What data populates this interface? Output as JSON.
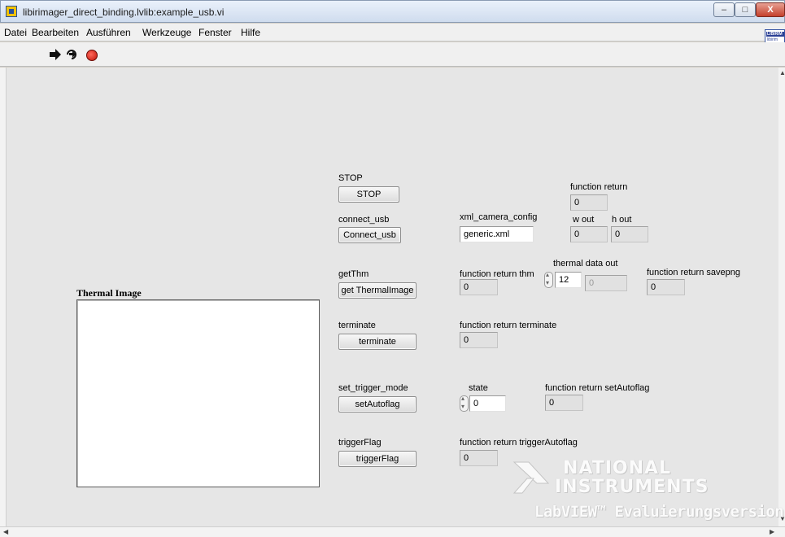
{
  "window": {
    "title": "libirimager_direct_binding.lvlib:example_usb.vi",
    "minimize_glyph": "–",
    "maximize_glyph": "□",
    "close_glyph": "X"
  },
  "menu": {
    "items": [
      "Datei",
      "Bearbeiten",
      "Ausführen",
      "Werkzeuge",
      "Fenster",
      "Hilfe"
    ]
  },
  "vi_icon": {
    "line1": "LIBIRIM",
    "line2": "libirim"
  },
  "toolbar": {
    "icons": [
      "run-arrow-icon",
      "run-continuously-icon",
      "abort-icon"
    ]
  },
  "panel": {
    "stop": {
      "label": "STOP",
      "button": "STOP"
    },
    "connect_usb": {
      "label": "connect_usb",
      "button": "Connect_usb"
    },
    "get_thm": {
      "label": "getThm",
      "button": "get ThermalImage"
    },
    "terminate": {
      "label": "terminate",
      "button": "terminate"
    },
    "set_trigger_mode": {
      "label": "set_trigger_mode",
      "button": "setAutoflag"
    },
    "trigger_flag": {
      "label": "triggerFlag",
      "button": "triggerFlag"
    },
    "thermal_image": {
      "label": "Thermal Image"
    },
    "function_return": {
      "label": "function return",
      "value": "0"
    },
    "xml_camera_config": {
      "label": "xml_camera_config",
      "value": "generic.xml"
    },
    "w_out": {
      "label": "w out",
      "value": "0"
    },
    "h_out": {
      "label": "h out",
      "value": "0"
    },
    "function_return_thm": {
      "label": "function return thm",
      "value": "0"
    },
    "thermal_data_out": {
      "label": "thermal data out",
      "index": "12",
      "value": "0"
    },
    "function_return_savepng": {
      "label": "function return savepng",
      "value": "0"
    },
    "function_return_terminate": {
      "label": "function return terminate",
      "value": "0"
    },
    "state": {
      "label": "state",
      "value": "0"
    },
    "function_return_setautoflag": {
      "label": "function return setAutoflag",
      "value": "0"
    },
    "function_return_triggerautoflag": {
      "label": "function return triggerAutoflag",
      "value": "0"
    }
  },
  "watermark": {
    "line1": "NATIONAL",
    "line2": "INSTRUMENTS",
    "line3": "LabVIEW™ Evaluierungsversion"
  }
}
